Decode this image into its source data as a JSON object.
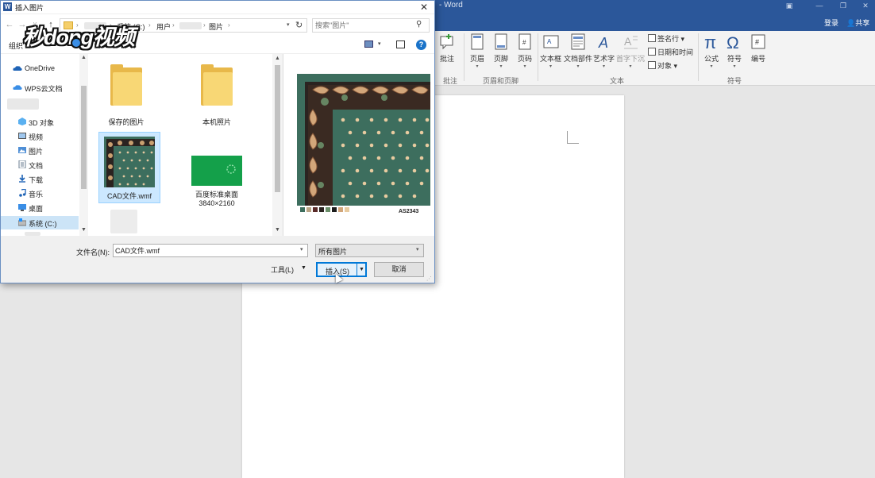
{
  "word": {
    "title": "- Word",
    "signin": "登录",
    "share": "共享",
    "window_controls": [
      "▣",
      "—",
      "❐",
      "✕"
    ],
    "ribbon": {
      "buttons": {
        "comment": "批注",
        "header": "页眉",
        "footer": "页脚",
        "page_number": "页码",
        "textbox": "文本框",
        "quick_parts": "文档部件",
        "wordart": "艺术字",
        "dropcap": "首字下沉",
        "equation": "公式",
        "symbol": "符号",
        "numbering": "编号"
      },
      "small_buttons": {
        "signature": "签名行",
        "datetime": "日期和时间",
        "object": "对象"
      },
      "groups": {
        "comment": "批注",
        "header_footer": "页眉和页脚",
        "text": "文本",
        "symbols": "符号"
      }
    }
  },
  "dialog": {
    "title": "插入图片",
    "close": "✕",
    "nav_buttons": [
      "←",
      "→",
      "˅",
      "↑"
    ],
    "breadcrumb": [
      "系统 (C:)",
      "用户",
      "图片"
    ],
    "search_placeholder": "搜索\"图片\"",
    "organize": "组织 ▾",
    "help": "?",
    "nav_pane": [
      {
        "label": "OneDrive",
        "icon": "onedrive-icon"
      },
      {
        "label": "WPS云文档",
        "icon": "wps-cloud-icon"
      },
      {
        "label": "3D 对象",
        "icon": "3d-objects-icon"
      },
      {
        "label": "视频",
        "icon": "video-icon"
      },
      {
        "label": "图片",
        "icon": "pictures-icon"
      },
      {
        "label": "文档",
        "icon": "documents-icon"
      },
      {
        "label": "下载",
        "icon": "download-icon"
      },
      {
        "label": "音乐",
        "icon": "music-icon"
      },
      {
        "label": "桌面",
        "icon": "desktop-icon"
      },
      {
        "label": "系统 (C:)",
        "icon": "drive-icon"
      }
    ],
    "files": [
      {
        "name": "保存的图片",
        "type": "folder"
      },
      {
        "name": "本机照片",
        "type": "folder"
      },
      {
        "name": "CAD文件.wmf",
        "type": "image",
        "selected": true
      },
      {
        "name": "百度标准桌面",
        "subtitle": "3840×2160",
        "type": "image"
      }
    ],
    "preview_code": "AS2343",
    "filename_label": "文件名(N):",
    "filename_value": "CAD文件.wmf",
    "filetype_value": "所有图片",
    "tools_label": "工具(L)",
    "insert_label": "插入(S)",
    "cancel_label": "取消"
  },
  "watermark": {
    "text": "秒dong视频"
  },
  "colors": {
    "word_blue": "#2b579a",
    "selection": "#cce8ff",
    "rug_green": "#3d6e5e",
    "accent_button": "#0078d7"
  }
}
